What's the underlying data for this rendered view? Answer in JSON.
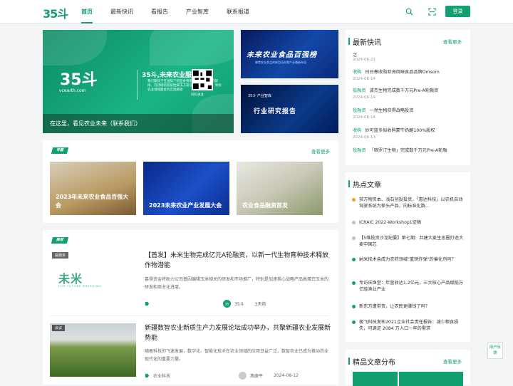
{
  "header": {
    "logo": "35斗",
    "nav": [
      "首页",
      "最新快讯",
      "看报告",
      "产业智库",
      "联系报道"
    ],
    "login": "登录"
  },
  "banner": {
    "caption": "在这里，看见农业未来（联系我们）",
    "logo": "35斗",
    "domain": "vcearth.com",
    "title": "35斗,未来农业服务平台",
    "subtitle": "我们聚焦于在国际下新型食物系统的构建，探究链接、可持续的系统性解决方案与价值链的重塑，寻找农业领域最优的实践路径",
    "qr_label": "扫码关注"
  },
  "side_banners": [
    {
      "title": "未来农业食品百强榜",
      "subtitle": "聚焦农业食品的新型风向和产业最新布局"
    },
    {
      "badge": "35斗 产业智库",
      "title": "行业研究报告"
    }
  ],
  "topics": {
    "tag": "专题",
    "more": "查看更多",
    "items": [
      "2023年未来农业食品百强大会",
      "2023未来农业产业发展大会",
      "农业食品融资首发"
    ]
  },
  "recommend": {
    "tag": "推荐",
    "articles": [
      {
        "label": "投融资",
        "title": "【首发】未米生物完成亿元A轮融资，以新一代生物育种技术释放作物潜能",
        "desc": "募得资金将助力公司基因编辑玉米相关的研发和市场推广，特别是加速核心战略产品高蛋白玉米的研发和商业化进度。",
        "author": "35斗",
        "time": "3天前",
        "logo_text": "未米",
        "logo_sub": "FOR FUTURE BREEDING"
      },
      {
        "label": "会议",
        "title": "新疆数智农业新质生产力发展论坛成功举办，共聚新疆农业发展新势能",
        "desc": "随着科技的飞速发展，数字化、智能化技术在农业领域的应用日益广泛，数智农业已成为推动农业现代化的重要力量。",
        "tag": "农业科技",
        "author": "燕庚平",
        "time": "2024-08-12"
      }
    ]
  },
  "latest": {
    "title": "最新快讯",
    "more": "查看更多",
    "items": [
      {
        "cat": "",
        "text": "之",
        "date": "2024-06-21"
      },
      {
        "cat": "收购",
        "text": "日日煮收购亚洲风味食品品牌Omsom",
        "date": "2024-06-14"
      },
      {
        "cat": "投融资",
        "text": "波杰生物完成数千万元Pre-A轮融资",
        "date": "2024-06-14"
      },
      {
        "cat": "投融资",
        "text": "一然生物获得战略投资",
        "date": "2024-06-14"
      },
      {
        "cat": "收购",
        "text": "妙可蓝多拟收购蒙牛奶酪100%股权",
        "date": "2024-06-13"
      },
      {
        "cat": "投融资",
        "text": "「暗罗汀生物」完成数千万元Pre-A轮融",
        "date": ""
      }
    ]
  },
  "hot": {
    "title": "热点文章",
    "items": [
      "获万物资本、浅石创投投资，「惠达科技」以农机自动驾驶系统为拳头产品，向标准化数...",
      "ICRAIC 2022-Workshop1征稿",
      "【5维投资沙龙纪要】第七期：共建大麦生态圈打造大麦中国芯",
      "纳米技术会成为农药领域\"重磅炸弹\"的催化剂吗？",
      "专访庆渔堂：年营收达1.2亿元，三大核心产品赋能万亿级渔业产业",
      "新东方遭带货，让农民更赚钱了吗？",
      "极飞科技发布2021企业社会责任报告：减少粮食损失，可满足 2084 万人口一年的需求"
    ]
  },
  "featured": {
    "title": "精品文章分布",
    "more": "查看更多"
  },
  "feedback": "用户反馈",
  "colors": {
    "accent": "#13a06f",
    "hot_dots": [
      "#f0a020",
      "#c0c0c0",
      "#c0c0c0",
      "#13a06f",
      "#13a06f",
      "#13a06f",
      "#13a06f"
    ]
  }
}
